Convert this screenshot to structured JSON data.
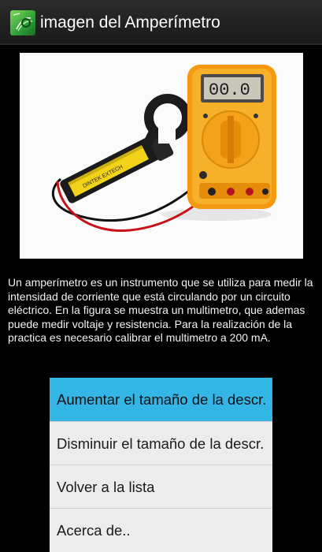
{
  "app": {
    "title": "imagen del Amperímetro",
    "icon": "ammeter-app-icon"
  },
  "photo": {
    "meter_display": "00.0",
    "icon": "ammeter-photo"
  },
  "description": {
    "text": "Un amperímetro es un instrumento que se utiliza para medir la intensidad de corriente que está circulando por un circuito eléctrico. En la figura se muestra un multimetro, que ademas puede medir voltaje y resistencia. Para la realización de la practica es necesario calibrar el multimetro a 200 mA."
  },
  "menu": {
    "items": [
      {
        "label": "Aumentar el tamaño de la descr.",
        "active": true
      },
      {
        "label": "Disminuir el tamaño de la descr.",
        "active": false
      },
      {
        "label": "Volver a la lista",
        "active": false
      },
      {
        "label": "Acerca de..",
        "active": false
      }
    ]
  },
  "colors": {
    "highlight": "#33b5e5",
    "menu_background": "#ececec",
    "background": "#000000"
  }
}
